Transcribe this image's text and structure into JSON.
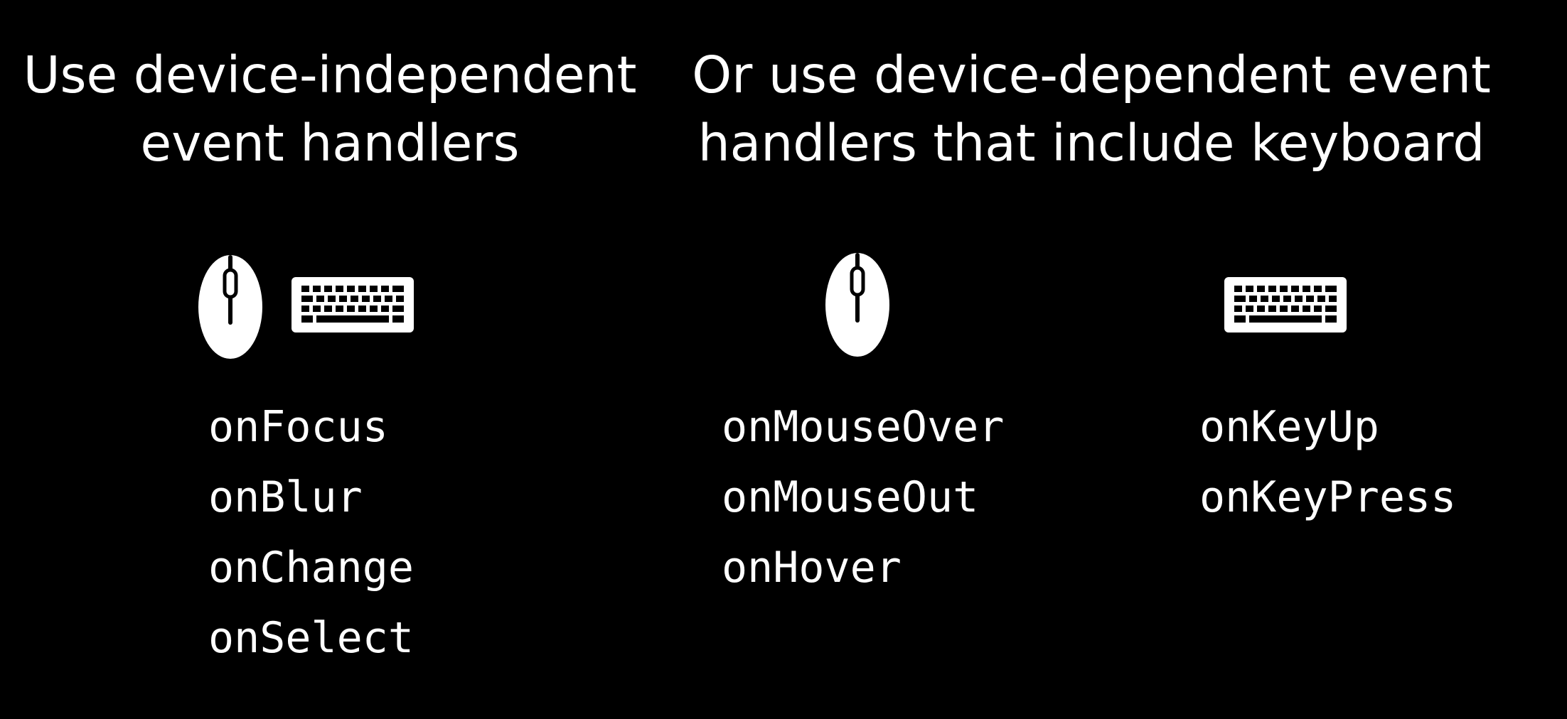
{
  "colors": {
    "background": "#000000",
    "foreground": "#ffffff"
  },
  "left_column": {
    "heading_line1": "Use device-independent",
    "heading_line2": "event handlers",
    "icons": [
      "mouse-icon",
      "keyboard-icon"
    ],
    "handlers": [
      "onFocus",
      "onBlur",
      "onChange",
      "onSelect"
    ]
  },
  "right_column": {
    "heading_line1": "Or use device-dependent event",
    "heading_line2": "handlers that include keyboard",
    "mouse_group": {
      "icon": "mouse-icon",
      "handlers": [
        "onMouseOver",
        "onMouseOut",
        "onHover"
      ]
    },
    "keyboard_group": {
      "icon": "keyboard-icon",
      "handlers": [
        "onKeyUp",
        "onKeyPress"
      ]
    }
  }
}
